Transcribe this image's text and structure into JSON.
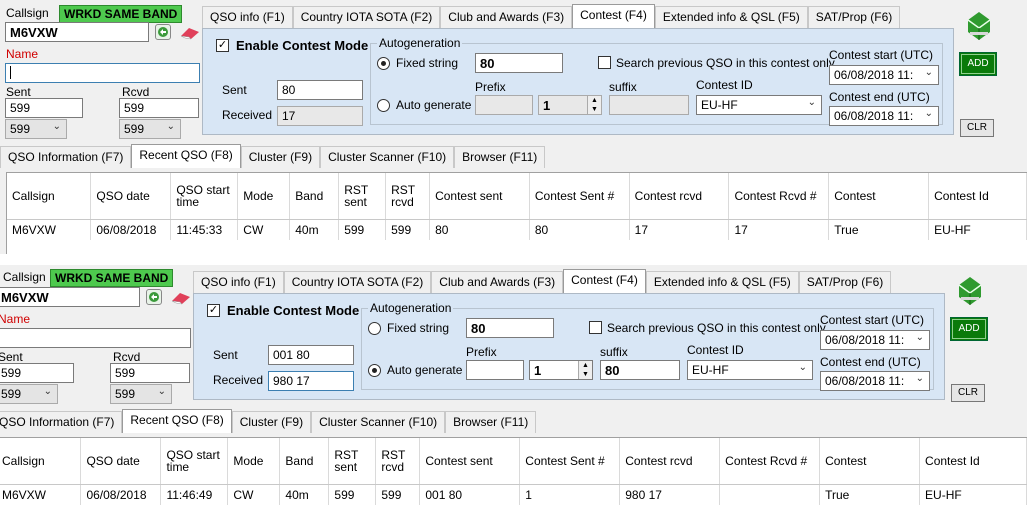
{
  "panes": [
    {
      "callsign_label": "Callsign",
      "callsign_value": "M6VXW",
      "band_badge": "WRKD SAME BAND",
      "name_label": "Name",
      "name_value": "",
      "sent_label": "Sent",
      "rcvd_label": "Rcvd",
      "sent_value": "599",
      "rcvd_value": "599",
      "sent_combo": "599",
      "rcvd_combo": "599",
      "tabs": [
        "QSO info (F1)",
        "Country IOTA SOTA (F2)",
        "Club and Awards (F3)",
        "Contest (F4)",
        "Extended info & QSL (F5)",
        "SAT/Prop (F6)"
      ],
      "enable_contest_label": "Enable Contest Mode",
      "contest_sent_label": "Sent",
      "contest_sent_value": "80",
      "contest_received_label": "Received",
      "contest_received_value": "17",
      "autogen_title": "Autogeneration",
      "fixed_string_label": "Fixed string",
      "fixed_string_value": "80",
      "auto_generate_label": "Auto generate",
      "prefix_label": "Prefix",
      "prefix_value": "",
      "counter_value": "1",
      "suffix_label": "suffix",
      "suffix_value": "",
      "search_prev_label": "Search previous QSO in this contest only",
      "contest_id_label": "Contest ID",
      "contest_id_value": "EU-HF",
      "contest_start_label": "Contest start (UTC)",
      "contest_start_value": "06/08/2018 11:",
      "contest_end_label": "Contest end (UTC)",
      "contest_end_value": "06/08/2018 11:",
      "add_label": "ADD",
      "clr_label": "CLR",
      "bottom_tabs": [
        "QSO Information (F7)",
        "Recent QSO (F8)",
        "Cluster (F9)",
        "Cluster Scanner (F10)",
        "Browser (F11)"
      ],
      "columns": [
        "Callsign",
        "QSO date",
        "QSO start time",
        "Mode",
        "Band",
        "RST sent",
        "RST rcvd",
        "Contest sent",
        "Contest Sent #",
        "Contest rcvd",
        "Contest Rcvd #",
        "Contest",
        "Contest Id"
      ],
      "row": [
        "M6VXW",
        "06/08/2018",
        "11:45:33",
        "CW",
        "40m",
        "599",
        "599",
        "80",
        "80",
        "17",
        "17",
        "True",
        "EU-HF"
      ]
    },
    {
      "callsign_label": "Callsign",
      "callsign_value": "M6VXW",
      "band_badge": "WRKD SAME BAND",
      "name_label": "Name",
      "name_value": "",
      "sent_label": "Sent",
      "rcvd_label": "Rcvd",
      "sent_value": "599",
      "rcvd_value": "599",
      "sent_combo": "599",
      "rcvd_combo": "599",
      "tabs": [
        "QSO info (F1)",
        "Country IOTA SOTA (F2)",
        "Club and Awards (F3)",
        "Contest (F4)",
        "Extended info & QSL (F5)",
        "SAT/Prop (F6)"
      ],
      "enable_contest_label": "Enable Contest Mode",
      "contest_sent_label": "Sent",
      "contest_sent_value": "001 80",
      "contest_received_label": "Received",
      "contest_received_value": "980 17",
      "autogen_title": "Autogeneration",
      "fixed_string_label": "Fixed string",
      "fixed_string_value": "80",
      "auto_generate_label": "Auto generate",
      "prefix_label": "Prefix",
      "prefix_value": "",
      "counter_value": "1",
      "suffix_label": "suffix",
      "suffix_value": "80",
      "search_prev_label": "Search previous QSO in this contest only",
      "contest_id_label": "Contest ID",
      "contest_id_value": "EU-HF",
      "contest_start_label": "Contest start (UTC)",
      "contest_start_value": "06/08/2018 11:",
      "contest_end_label": "Contest end (UTC)",
      "contest_end_value": "06/08/2018 11:",
      "add_label": "ADD",
      "clr_label": "CLR",
      "bottom_tabs": [
        "QSO Information (F7)",
        "Recent QSO (F8)",
        "Cluster (F9)",
        "Cluster Scanner (F10)",
        "Browser (F11)"
      ],
      "columns": [
        "Callsign",
        "QSO date",
        "QSO start time",
        "Mode",
        "Band",
        "RST sent",
        "RST rcvd",
        "Contest sent",
        "Contest Sent #",
        "Contest rcvd",
        "Contest Rcvd #",
        "Contest",
        "Contest Id"
      ],
      "row": [
        "M6VXW",
        "06/08/2018",
        "11:46:49",
        "CW",
        "40m",
        "599",
        "599",
        "001 80",
        "1",
        "980 17",
        "",
        "True",
        "EU-HF"
      ]
    }
  ]
}
